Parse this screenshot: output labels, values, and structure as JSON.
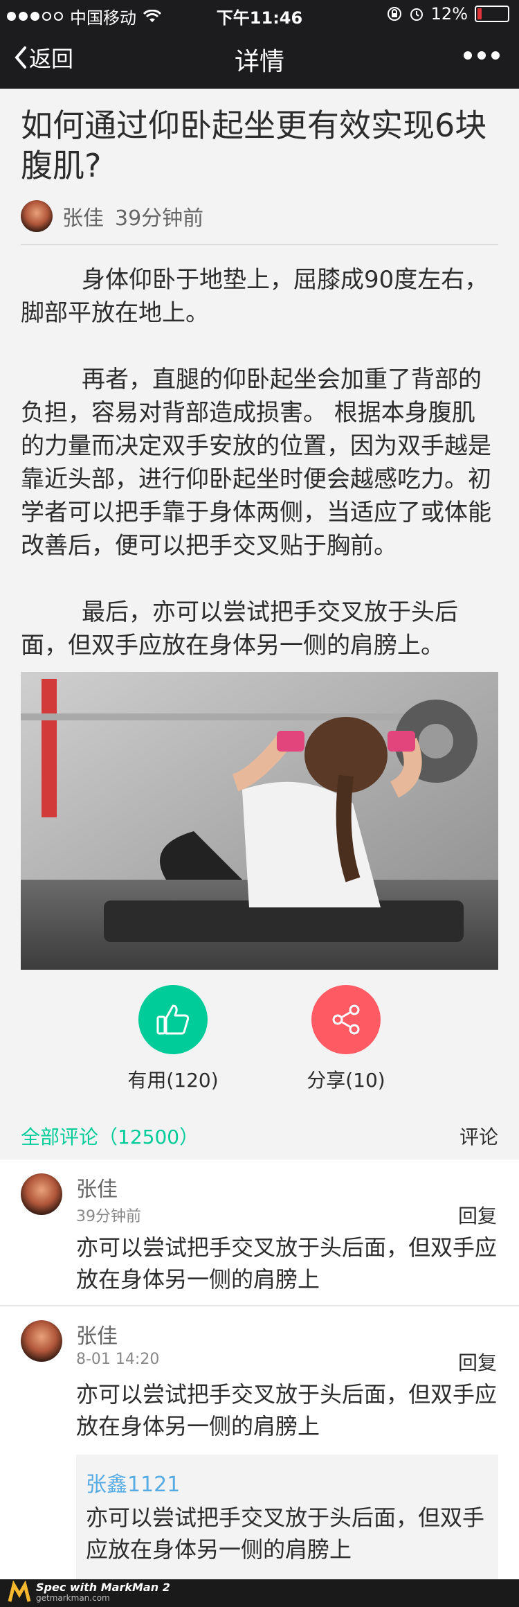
{
  "status": {
    "carrier": "中国移动",
    "time": "下午11:46",
    "battery": "12%"
  },
  "nav": {
    "back_label": "返回",
    "title": "详情"
  },
  "article": {
    "title": "如何通过仰卧起坐更有效实现6块腹肌?",
    "author": "张佳",
    "time": "39分钟前",
    "paragraphs": [
      "身体仰卧于地垫上，屈膝成90度左右，脚部平放在地上。",
      "再者，直腿的仰卧起坐会加重了背部的负担，容易对背部造成损害。 根据本身腹肌的力量而决定双手安放的位置，因为双手越是靠近头部，进行仰卧起坐时便会越感吃力。初学者可以把手靠于身体两侧，当适应了或体能改善后，便可以把手交叉贴于胸前。",
      "最后，亦可以尝试把手交叉放于头后面，但双手应放在身体另一侧的肩膀上。"
    ]
  },
  "actions": {
    "useful_label": "有用(120)",
    "share_label": "分享(10)",
    "useful_color": "#00cc99",
    "share_color": "#fe5a63"
  },
  "comments_header": {
    "all_label": "全部评论（12500）",
    "write_label": "评论"
  },
  "comments": [
    {
      "name": "张佳",
      "time": "39分钟前",
      "reply_label": "回复",
      "text": "亦可以尝试把手交叉放于头后面，但双手应放在身体另一侧的肩膀上"
    },
    {
      "name": "张佳",
      "time": "8-01 14:20",
      "reply_label": "回复",
      "text": "亦可以尝试把手交叉放于头后面，但双手应放在身体另一侧的肩膀上",
      "quote": {
        "name": "张鑫1121",
        "text": "亦可以尝试把手交叉放于头后面，但双手应放在身体另一侧的肩膀上"
      }
    }
  ],
  "footer": {
    "brand": "Spec with MarkMan 2",
    "url": "getmarkman.com"
  }
}
